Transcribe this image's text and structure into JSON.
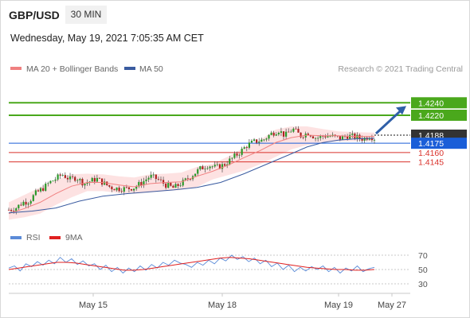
{
  "header": {
    "symbol": "GBP/USD",
    "timeframe": "30 MIN",
    "datetime": "Wednesday, May 19, 2021 7:05:35 AM CET"
  },
  "legend": [
    {
      "label": "MA 20 + Bollinger Bands",
      "color": "#f08080"
    },
    {
      "label": "MA 50",
      "color": "#3a5ba0"
    }
  ],
  "rsi_legend": [
    {
      "label": "RSI",
      "color": "#5b8bd8"
    },
    {
      "label": "9MA",
      "color": "#e02020"
    }
  ],
  "credit": "Research © 2021 Trading Central",
  "colors": {
    "bull": "#2a9a2a",
    "bear": "#b02020",
    "resistance": "#4aa81c",
    "current": "#333333",
    "pivot": "#1a5ed8",
    "support": "#d9302a",
    "arrow": "#2f5fa8",
    "band_fill": "#fde2e2"
  },
  "chart_data": [
    {
      "type": "candlestick",
      "ylim": [
        1.405,
        1.428
      ],
      "price_levels": [
        {
          "label": "1.4240",
          "value": 1.424,
          "kind": "resistance"
        },
        {
          "label": "1.4220",
          "value": 1.422,
          "kind": "resistance"
        },
        {
          "label": "1.4188",
          "value": 1.4188,
          "kind": "current"
        },
        {
          "label": "1.4175",
          "value": 1.4175,
          "kind": "pivot"
        },
        {
          "label": "1.4160",
          "value": 1.416,
          "kind": "support"
        },
        {
          "label": "1.4145",
          "value": 1.4145,
          "kind": "support"
        }
      ],
      "x_labels": [
        "May 15",
        "May 18",
        "May 19",
        "May 27"
      ],
      "close_path": [
        [
          0,
          1.4068
        ],
        [
          8,
          1.407
        ],
        [
          18,
          1.408
        ],
        [
          26,
          1.4082
        ],
        [
          34,
          1.4094
        ],
        [
          44,
          1.4103
        ],
        [
          52,
          1.4112
        ],
        [
          60,
          1.4118
        ],
        [
          68,
          1.4125
        ],
        [
          78,
          1.4117
        ],
        [
          86,
          1.412
        ],
        [
          96,
          1.411
        ],
        [
          104,
          1.4114
        ],
        [
          112,
          1.4118
        ],
        [
          122,
          1.411
        ],
        [
          130,
          1.4104
        ],
        [
          140,
          1.4102
        ],
        [
          150,
          1.4102
        ],
        [
          160,
          1.4104
        ],
        [
          170,
          1.4112
        ],
        [
          180,
          1.4122
        ],
        [
          190,
          1.4117
        ],
        [
          200,
          1.4108
        ],
        [
          210,
          1.4103
        ],
        [
          222,
          1.4112
        ],
        [
          232,
          1.4122
        ],
        [
          244,
          1.4134
        ],
        [
          254,
          1.414
        ],
        [
          264,
          1.4136
        ],
        [
          274,
          1.414
        ],
        [
          284,
          1.415
        ],
        [
          294,
          1.416
        ],
        [
          304,
          1.4172
        ],
        [
          314,
          1.4178
        ],
        [
          324,
          1.418
        ],
        [
          334,
          1.419
        ],
        [
          344,
          1.4196
        ],
        [
          352,
          1.4187
        ],
        [
          362,
          1.4198
        ],
        [
          372,
          1.4187
        ],
        [
          382,
          1.4192
        ],
        [
          392,
          1.4183
        ],
        [
          402,
          1.4187
        ],
        [
          412,
          1.4186
        ],
        [
          422,
          1.4183
        ],
        [
          432,
          1.4187
        ],
        [
          442,
          1.4185
        ],
        [
          452,
          1.4182
        ],
        [
          460,
          1.4187
        ],
        [
          466,
          1.4183
        ]
      ],
      "ma20_path": [
        [
          0,
          1.4062
        ],
        [
          20,
          1.407
        ],
        [
          40,
          1.408
        ],
        [
          60,
          1.4094
        ],
        [
          80,
          1.4106
        ],
        [
          100,
          1.4112
        ],
        [
          120,
          1.4112
        ],
        [
          140,
          1.4108
        ],
        [
          160,
          1.4105
        ],
        [
          180,
          1.411
        ],
        [
          200,
          1.4112
        ],
        [
          220,
          1.4113
        ],
        [
          240,
          1.4122
        ],
        [
          260,
          1.413
        ],
        [
          280,
          1.414
        ],
        [
          300,
          1.4152
        ],
        [
          320,
          1.4163
        ],
        [
          340,
          1.4176
        ],
        [
          360,
          1.4184
        ],
        [
          380,
          1.4188
        ],
        [
          400,
          1.4187
        ],
        [
          420,
          1.4187
        ],
        [
          440,
          1.4186
        ],
        [
          466,
          1.4186
        ]
      ],
      "band_upper": [
        [
          0,
          1.408
        ],
        [
          20,
          1.4092
        ],
        [
          40,
          1.4104
        ],
        [
          60,
          1.4116
        ],
        [
          80,
          1.4125
        ],
        [
          100,
          1.4126
        ],
        [
          120,
          1.4125
        ],
        [
          140,
          1.4122
        ],
        [
          160,
          1.412
        ],
        [
          180,
          1.4125
        ],
        [
          200,
          1.4126
        ],
        [
          220,
          1.4128
        ],
        [
          240,
          1.4137
        ],
        [
          260,
          1.4142
        ],
        [
          280,
          1.4154
        ],
        [
          300,
          1.4168
        ],
        [
          320,
          1.418
        ],
        [
          340,
          1.4197
        ],
        [
          360,
          1.4202
        ],
        [
          380,
          1.4202
        ],
        [
          400,
          1.4198
        ],
        [
          420,
          1.4194
        ],
        [
          440,
          1.4193
        ],
        [
          466,
          1.4192
        ]
      ],
      "band_lower": [
        [
          466,
          1.4178
        ],
        [
          440,
          1.4178
        ],
        [
          420,
          1.4178
        ],
        [
          400,
          1.4176
        ],
        [
          380,
          1.4172
        ],
        [
          360,
          1.4165
        ],
        [
          340,
          1.4153
        ],
        [
          320,
          1.4141
        ],
        [
          300,
          1.4131
        ],
        [
          280,
          1.4124
        ],
        [
          260,
          1.4117
        ],
        [
          240,
          1.4105
        ],
        [
          220,
          1.41
        ],
        [
          200,
          1.4098
        ],
        [
          180,
          1.4096
        ],
        [
          160,
          1.4094
        ],
        [
          140,
          1.4095
        ],
        [
          120,
          1.4098
        ],
        [
          100,
          1.4098
        ],
        [
          80,
          1.4088
        ],
        [
          60,
          1.4076
        ],
        [
          40,
          1.4062
        ],
        [
          20,
          1.4056
        ],
        [
          0,
          1.4052
        ]
      ],
      "ma50_path": [
        [
          0,
          1.4063
        ],
        [
          30,
          1.4066
        ],
        [
          60,
          1.4071
        ],
        [
          90,
          1.4082
        ],
        [
          120,
          1.409
        ],
        [
          150,
          1.4094
        ],
        [
          180,
          1.4097
        ],
        [
          210,
          1.41
        ],
        [
          240,
          1.4104
        ],
        [
          270,
          1.4112
        ],
        [
          300,
          1.4126
        ],
        [
          330,
          1.4142
        ],
        [
          360,
          1.4158
        ],
        [
          380,
          1.4169
        ],
        [
          400,
          1.4176
        ],
        [
          420,
          1.418
        ],
        [
          440,
          1.4182
        ],
        [
          466,
          1.4183
        ]
      ]
    },
    {
      "type": "line",
      "ylim": [
        20,
        80
      ],
      "y_ticks": [
        70,
        50,
        30
      ],
      "rsi_values": [
        52,
        55,
        48,
        58,
        54,
        61,
        56,
        63,
        58,
        67,
        60,
        65,
        57,
        62,
        55,
        58,
        50,
        56,
        47,
        53,
        45,
        52,
        47,
        55,
        49,
        57,
        52,
        60,
        56,
        63,
        59,
        57,
        53,
        60,
        56,
        63,
        58,
        66,
        62,
        70,
        64,
        68,
        61,
        66,
        58,
        63,
        54,
        59,
        50,
        56,
        47,
        53,
        48,
        54,
        50,
        55,
        47,
        53,
        45,
        52,
        48,
        55,
        47,
        51,
        53
      ],
      "ma9_values": [
        50,
        52,
        54,
        56,
        58,
        60,
        60,
        59,
        57,
        55,
        53,
        51,
        49,
        49,
        50,
        52,
        54,
        56,
        58,
        60,
        62,
        64,
        66,
        67,
        66,
        65,
        63,
        61,
        59,
        57,
        55,
        53,
        52,
        51,
        50,
        50,
        49,
        49,
        50
      ]
    }
  ]
}
